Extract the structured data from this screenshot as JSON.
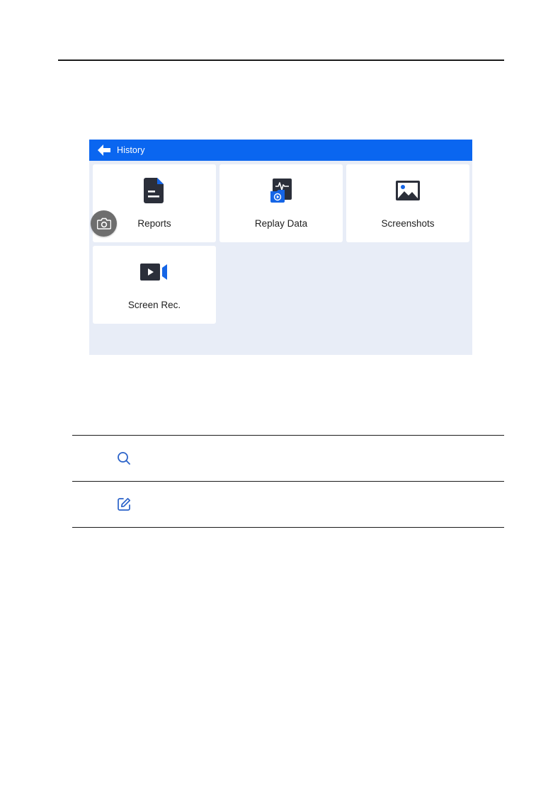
{
  "screen": {
    "header": {
      "title": "History",
      "back_icon": "arrow-left-icon"
    },
    "tiles": [
      {
        "label": "Reports",
        "icon": "document-icon"
      },
      {
        "label": "Replay Data",
        "icon": "replay-data-icon"
      },
      {
        "label": "Screenshots",
        "icon": "image-icon"
      },
      {
        "label": "Screen Rec.",
        "icon": "video-camera-icon"
      }
    ],
    "floating_button_icon": "camera-icon"
  },
  "notes": [
    {
      "icon": "search-icon"
    },
    {
      "icon": "edit-icon"
    }
  ],
  "colors": {
    "header_blue": "#0a66f0",
    "screen_bg": "#e8edf7",
    "icon_dark": "#2b2f3a",
    "accent_blue": "#1565e6",
    "note_icon_blue": "#2a62c9",
    "floating_grey": "#6e6e6e"
  }
}
